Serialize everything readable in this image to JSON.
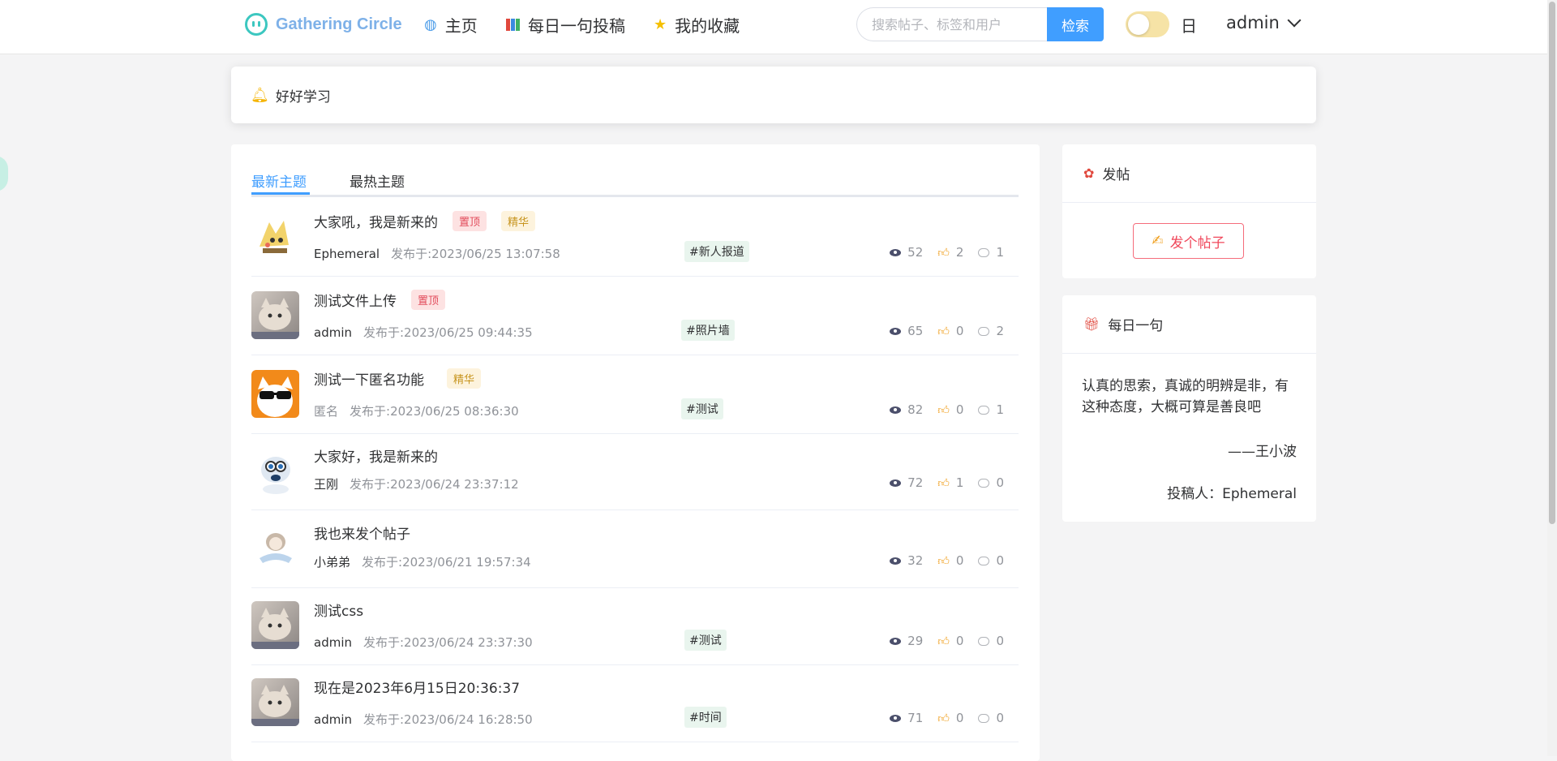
{
  "header": {
    "logo_text": "Gathering Circle",
    "nav": [
      {
        "label": "主页",
        "icon": "globe-icon"
      },
      {
        "label": "每日一句投稿",
        "icon": "books-icon"
      },
      {
        "label": "我的收藏",
        "icon": "star-icon"
      }
    ],
    "search": {
      "placeholder": "搜索帖子、标签和用户",
      "button": "检索"
    },
    "theme_label": "日",
    "user": "admin"
  },
  "notice": {
    "text": "好好学习"
  },
  "tabs": [
    {
      "label": "最新主题",
      "active": true
    },
    {
      "label": "最热主题",
      "active": false
    }
  ],
  "posts": [
    {
      "title": "大家吼，我是新来的",
      "badges": [
        "置顶",
        "精华"
      ],
      "author": "Ephemeral",
      "time": "发布于:2023/06/25 13:07:58",
      "tag": "#新人报道",
      "views": "52",
      "likes": "2",
      "comments": "1"
    },
    {
      "title": "测试文件上传",
      "badges": [
        "置顶"
      ],
      "author": "admin",
      "time": "发布于:2023/06/25 09:44:35",
      "tag": "#照片墙",
      "views": "65",
      "likes": "0",
      "comments": "2"
    },
    {
      "title": "测试一下匿名功能",
      "badges": [
        "精华"
      ],
      "author": "匿名",
      "time": "发布于:2023/06/25 08:36:30",
      "tag": "#测试",
      "views": "82",
      "likes": "0",
      "comments": "1"
    },
    {
      "title": "大家好，我是新来的",
      "badges": [],
      "author": "王刚",
      "time": "发布于:2023/06/24 23:37:12",
      "tag": "",
      "views": "72",
      "likes": "1",
      "comments": "0"
    },
    {
      "title": "我也来发个帖子",
      "badges": [],
      "author": "小弟弟",
      "time": "发布于:2023/06/21 19:57:34",
      "tag": "",
      "views": "32",
      "likes": "0",
      "comments": "0"
    },
    {
      "title": "测试css",
      "badges": [],
      "author": "admin",
      "time": "发布于:2023/06/24 23:37:30",
      "tag": "#测试",
      "views": "29",
      "likes": "0",
      "comments": "0"
    },
    {
      "title": "现在是2023年6月15日20:36:37",
      "badges": [],
      "author": "admin",
      "time": "发布于:2023/06/24 16:28:50",
      "tag": "#时间",
      "views": "71",
      "likes": "0",
      "comments": "0"
    }
  ],
  "post_card": {
    "title": "发帖",
    "button": "发个帖子"
  },
  "daily_card": {
    "title": "每日一句",
    "quote": "认真的思索，真诚的明辨是非，有这种态度，大概可算是善良吧",
    "author": "——王小波",
    "poster": "投稿人：Ephemeral"
  },
  "colors": {
    "accent": "#409eff",
    "badge_top": "#e24b5b",
    "badge_best": "#c7951f",
    "post_button": "#f0485b"
  }
}
